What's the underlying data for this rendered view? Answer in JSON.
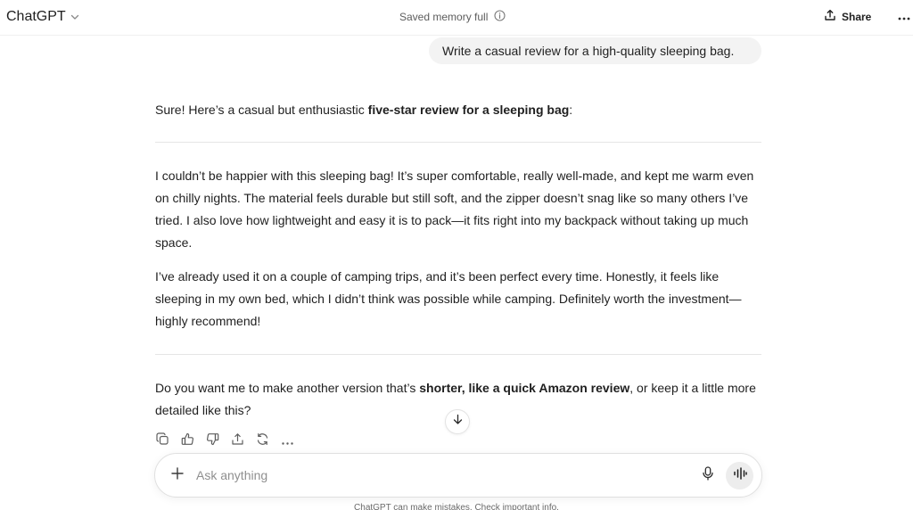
{
  "header": {
    "model_name": "ChatGPT",
    "memory_status": "Saved memory full",
    "share_label": "Share"
  },
  "user_message": "Write a casual review for a high-quality sleeping bag.",
  "assistant": {
    "intro_before": "Sure! Here’s a casual but enthusiastic ",
    "intro_bold": "five-star review for a sleeping bag",
    "intro_after": ":",
    "review_paragraph_1": "I couldn’t be happier with this sleeping bag! It’s super comfortable, really well-made, and kept me warm even on chilly nights. The material feels durable but still soft, and the zipper doesn’t snag like so many others I’ve tried. I also love how lightweight and easy it is to pack—it fits right into my backpack without taking up much space.",
    "review_paragraph_2": "I’ve already used it on a couple of camping trips, and it’s been perfect every time. Honestly, it feels like sleeping in my own bed, which I didn’t think was possible while camping. Definitely worth the investment—highly recommend!",
    "followup_before": "Do you want me to make another version that’s ",
    "followup_bold": "shorter, like a quick Amazon review",
    "followup_after": ", or keep it a little more detailed like this?"
  },
  "composer": {
    "placeholder": "Ask anything"
  },
  "footer": {
    "disclaimer": "ChatGPT can make mistakes. Check important info."
  },
  "icons": {
    "chevron": "chevron-down-icon",
    "info": "info-icon",
    "share": "share-icon",
    "more": "more-horizontal-icon",
    "copy": "copy-icon",
    "thumbs_up": "thumbs-up-icon",
    "thumbs_down": "thumbs-down-icon",
    "upload": "share-upload-icon",
    "regenerate": "regenerate-icon",
    "scroll_down": "arrow-down-icon",
    "plus": "plus-icon",
    "mic": "microphone-icon",
    "voice": "voice-mode-icon"
  }
}
